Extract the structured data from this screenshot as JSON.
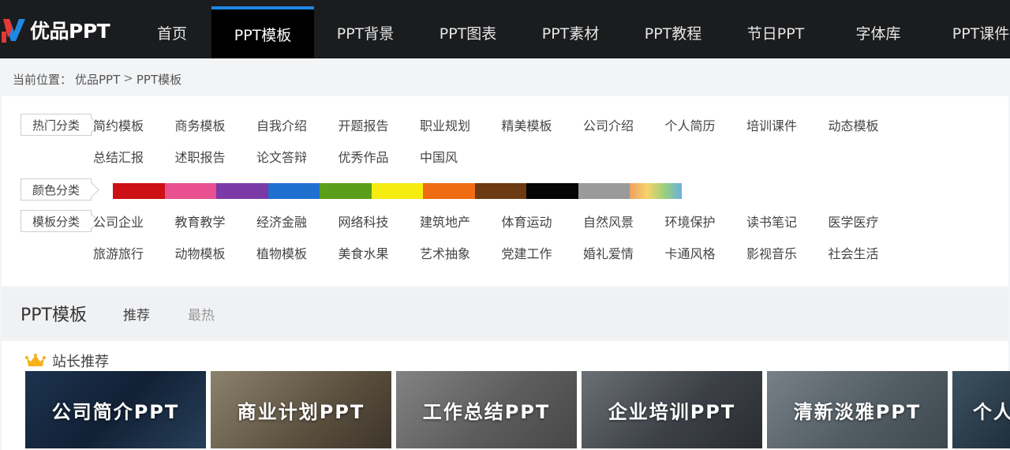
{
  "brand": {
    "name": "优品PPT"
  },
  "nav": {
    "items": [
      {
        "label": "首页"
      },
      {
        "label": "PPT模板"
      },
      {
        "label": "PPT背景"
      },
      {
        "label": "PPT图表"
      },
      {
        "label": "PPT素材"
      },
      {
        "label": "PPT教程"
      },
      {
        "label": "节日PPT"
      },
      {
        "label": "字体库"
      },
      {
        "label": "PPT课件"
      }
    ],
    "active_index": 1
  },
  "breadcrumb": {
    "prefix": "当前位置：",
    "home": "优品PPT",
    "separator": ">",
    "current": "PPT模板"
  },
  "categories": {
    "hot": {
      "label": "热门分类",
      "items": [
        "简约模板",
        "商务模板",
        "自我介绍",
        "开题报告",
        "职业规划",
        "精美模板",
        "公司介绍",
        "个人简历",
        "培训课件",
        "动态模板",
        "总结汇报",
        "述职报告",
        "论文答辩",
        "优秀作品",
        "中国风"
      ]
    },
    "color": {
      "label": "颜色分类",
      "swatches": [
        "#cc1015",
        "#e8508f",
        "#7b3aa8",
        "#2070cf",
        "#5b9e1a",
        "#f7ec0f",
        "#f06c12",
        "#6d3a11",
        "#050505",
        "#9a9a9a",
        "rainbow"
      ]
    },
    "template": {
      "label": "模板分类",
      "items": [
        "公司企业",
        "教育教学",
        "经济金融",
        "网络科技",
        "建筑地产",
        "体育运动",
        "自然风景",
        "环境保护",
        "读书笔记",
        "医学医疗",
        "旅游旅行",
        "动物模板",
        "植物模板",
        "美食水果",
        "艺术抽象",
        "党建工作",
        "婚礼爱情",
        "卡通风格",
        "影视音乐",
        "社会生活"
      ]
    }
  },
  "section": {
    "title": "PPT模板",
    "tabs": [
      "推荐",
      "最热"
    ]
  },
  "featured": {
    "heading": "站长推荐",
    "cards": [
      "公司简介PPT",
      "商业计划PPT",
      "工作总结PPT",
      "企业培训PPT",
      "清新淡雅PPT",
      "个人"
    ]
  }
}
